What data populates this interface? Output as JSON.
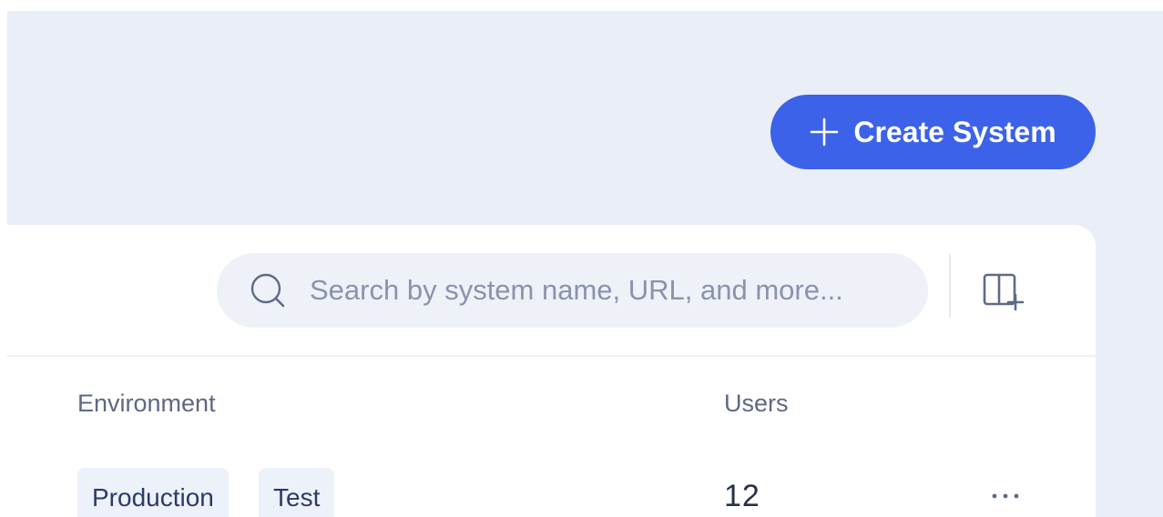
{
  "header": {
    "create_button": {
      "label": "Create System",
      "icon": "plus-icon"
    }
  },
  "toolbar": {
    "search": {
      "placeholder": "Search by system name, URL, and more...",
      "value": "",
      "icon": "search-icon"
    },
    "columns_button": {
      "icon": "add-column-icon"
    }
  },
  "table": {
    "columns": [
      "Environment",
      "Users"
    ],
    "rows": [
      {
        "environments": [
          "Production",
          "Test"
        ],
        "users": "12",
        "actions_icon": "more-horizontal-icon"
      }
    ]
  },
  "colors": {
    "accent": "#3b62e8",
    "page_background": "#eaeef7",
    "card_background": "#ffffff",
    "tag_background": "#edf1f9"
  }
}
